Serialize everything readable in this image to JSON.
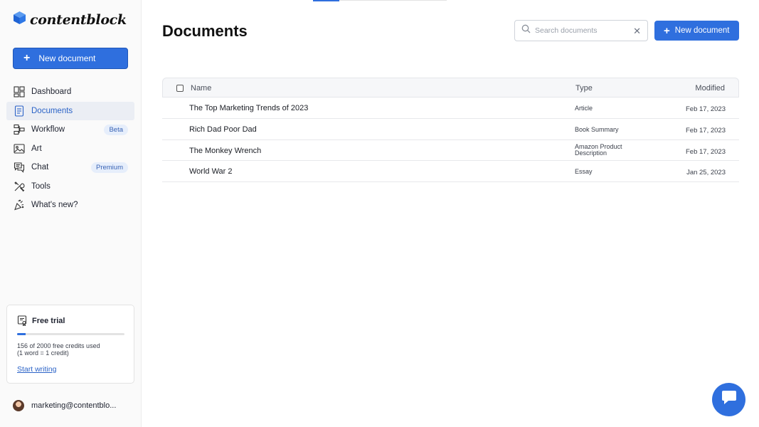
{
  "brand": {
    "name": "contentblock",
    "accent": "#2f6fde"
  },
  "sidebar": {
    "new_doc_label": "New document",
    "items": [
      {
        "label": "Dashboard",
        "icon": "dashboard-icon"
      },
      {
        "label": "Documents",
        "icon": "documents-icon",
        "active": true
      },
      {
        "label": "Workflow",
        "icon": "workflow-icon",
        "badge": "Beta"
      },
      {
        "label": "Art",
        "icon": "image-icon"
      },
      {
        "label": "Chat",
        "icon": "chat-icon",
        "badge": "Premium"
      },
      {
        "label": "Tools",
        "icon": "tools-icon"
      },
      {
        "label": "What's new?",
        "icon": "party-popper-icon"
      }
    ],
    "trial": {
      "title": "Free trial",
      "progress": 0.078,
      "credits_text": "156 of 2000 free credits used",
      "credits_note": "(1 word = 1 credit)",
      "link": "Start writing"
    },
    "user_email": "marketing@contentblo..."
  },
  "main": {
    "title": "Documents",
    "search_placeholder": "Search documents",
    "new_doc_label": "New document",
    "table": {
      "headers": {
        "name": "Name",
        "type": "Type",
        "modified": "Modified"
      },
      "rows": [
        {
          "name": "The Top Marketing Trends of 2023",
          "type": "Article",
          "modified": "Feb 17, 2023"
        },
        {
          "name": "Rich Dad Poor Dad",
          "type": "Book Summary",
          "modified": "Feb 17, 2023"
        },
        {
          "name": "The Monkey Wrench",
          "type": "Amazon Product Description",
          "modified": "Feb 17, 2023"
        },
        {
          "name": "World War 2",
          "type": "Essay",
          "modified": "Jan 25, 2023"
        }
      ]
    }
  }
}
